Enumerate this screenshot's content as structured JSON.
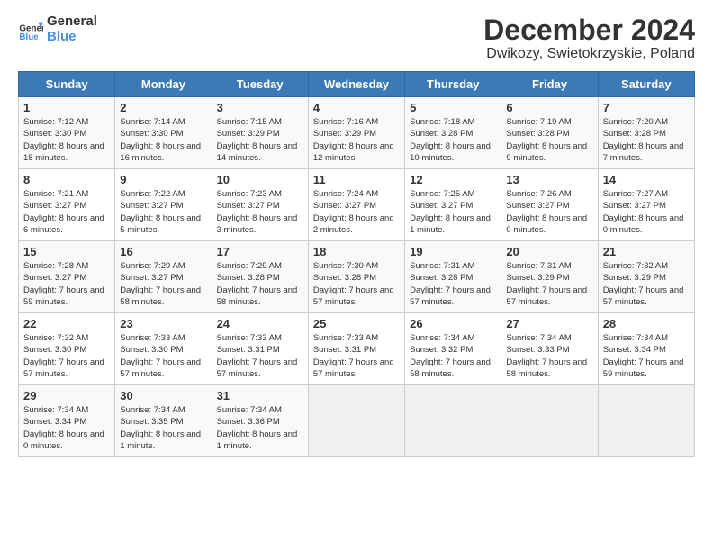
{
  "header": {
    "logo_line1": "General",
    "logo_line2": "Blue",
    "title": "December 2024",
    "subtitle": "Dwikozy, Swietokrzyskie, Poland"
  },
  "days_of_week": [
    "Sunday",
    "Monday",
    "Tuesday",
    "Wednesday",
    "Thursday",
    "Friday",
    "Saturday"
  ],
  "weeks": [
    [
      {
        "day": 1,
        "sunrise": "7:12 AM",
        "sunset": "3:30 PM",
        "daylight": "8 hours and 18 minutes."
      },
      {
        "day": 2,
        "sunrise": "7:14 AM",
        "sunset": "3:30 PM",
        "daylight": "8 hours and 16 minutes."
      },
      {
        "day": 3,
        "sunrise": "7:15 AM",
        "sunset": "3:29 PM",
        "daylight": "8 hours and 14 minutes."
      },
      {
        "day": 4,
        "sunrise": "7:16 AM",
        "sunset": "3:29 PM",
        "daylight": "8 hours and 12 minutes."
      },
      {
        "day": 5,
        "sunrise": "7:18 AM",
        "sunset": "3:28 PM",
        "daylight": "8 hours and 10 minutes."
      },
      {
        "day": 6,
        "sunrise": "7:19 AM",
        "sunset": "3:28 PM",
        "daylight": "8 hours and 9 minutes."
      },
      {
        "day": 7,
        "sunrise": "7:20 AM",
        "sunset": "3:28 PM",
        "daylight": "8 hours and 7 minutes."
      }
    ],
    [
      {
        "day": 8,
        "sunrise": "7:21 AM",
        "sunset": "3:27 PM",
        "daylight": "8 hours and 6 minutes."
      },
      {
        "day": 9,
        "sunrise": "7:22 AM",
        "sunset": "3:27 PM",
        "daylight": "8 hours and 5 minutes."
      },
      {
        "day": 10,
        "sunrise": "7:23 AM",
        "sunset": "3:27 PM",
        "daylight": "8 hours and 3 minutes."
      },
      {
        "day": 11,
        "sunrise": "7:24 AM",
        "sunset": "3:27 PM",
        "daylight": "8 hours and 2 minutes."
      },
      {
        "day": 12,
        "sunrise": "7:25 AM",
        "sunset": "3:27 PM",
        "daylight": "8 hours and 1 minute."
      },
      {
        "day": 13,
        "sunrise": "7:26 AM",
        "sunset": "3:27 PM",
        "daylight": "8 hours and 0 minutes."
      },
      {
        "day": 14,
        "sunrise": "7:27 AM",
        "sunset": "3:27 PM",
        "daylight": "8 hours and 0 minutes."
      }
    ],
    [
      {
        "day": 15,
        "sunrise": "7:28 AM",
        "sunset": "3:27 PM",
        "daylight": "7 hours and 59 minutes."
      },
      {
        "day": 16,
        "sunrise": "7:29 AM",
        "sunset": "3:27 PM",
        "daylight": "7 hours and 58 minutes."
      },
      {
        "day": 17,
        "sunrise": "7:29 AM",
        "sunset": "3:28 PM",
        "daylight": "7 hours and 58 minutes."
      },
      {
        "day": 18,
        "sunrise": "7:30 AM",
        "sunset": "3:28 PM",
        "daylight": "7 hours and 57 minutes."
      },
      {
        "day": 19,
        "sunrise": "7:31 AM",
        "sunset": "3:28 PM",
        "daylight": "7 hours and 57 minutes."
      },
      {
        "day": 20,
        "sunrise": "7:31 AM",
        "sunset": "3:29 PM",
        "daylight": "7 hours and 57 minutes."
      },
      {
        "day": 21,
        "sunrise": "7:32 AM",
        "sunset": "3:29 PM",
        "daylight": "7 hours and 57 minutes."
      }
    ],
    [
      {
        "day": 22,
        "sunrise": "7:32 AM",
        "sunset": "3:30 PM",
        "daylight": "7 hours and 57 minutes."
      },
      {
        "day": 23,
        "sunrise": "7:33 AM",
        "sunset": "3:30 PM",
        "daylight": "7 hours and 57 minutes."
      },
      {
        "day": 24,
        "sunrise": "7:33 AM",
        "sunset": "3:31 PM",
        "daylight": "7 hours and 57 minutes."
      },
      {
        "day": 25,
        "sunrise": "7:33 AM",
        "sunset": "3:31 PM",
        "daylight": "7 hours and 57 minutes."
      },
      {
        "day": 26,
        "sunrise": "7:34 AM",
        "sunset": "3:32 PM",
        "daylight": "7 hours and 58 minutes."
      },
      {
        "day": 27,
        "sunrise": "7:34 AM",
        "sunset": "3:33 PM",
        "daylight": "7 hours and 58 minutes."
      },
      {
        "day": 28,
        "sunrise": "7:34 AM",
        "sunset": "3:34 PM",
        "daylight": "7 hours and 59 minutes."
      }
    ],
    [
      {
        "day": 29,
        "sunrise": "7:34 AM",
        "sunset": "3:34 PM",
        "daylight": "8 hours and 0 minutes."
      },
      {
        "day": 30,
        "sunrise": "7:34 AM",
        "sunset": "3:35 PM",
        "daylight": "8 hours and 1 minute."
      },
      {
        "day": 31,
        "sunrise": "7:34 AM",
        "sunset": "3:36 PM",
        "daylight": "8 hours and 1 minute."
      },
      null,
      null,
      null,
      null
    ]
  ]
}
